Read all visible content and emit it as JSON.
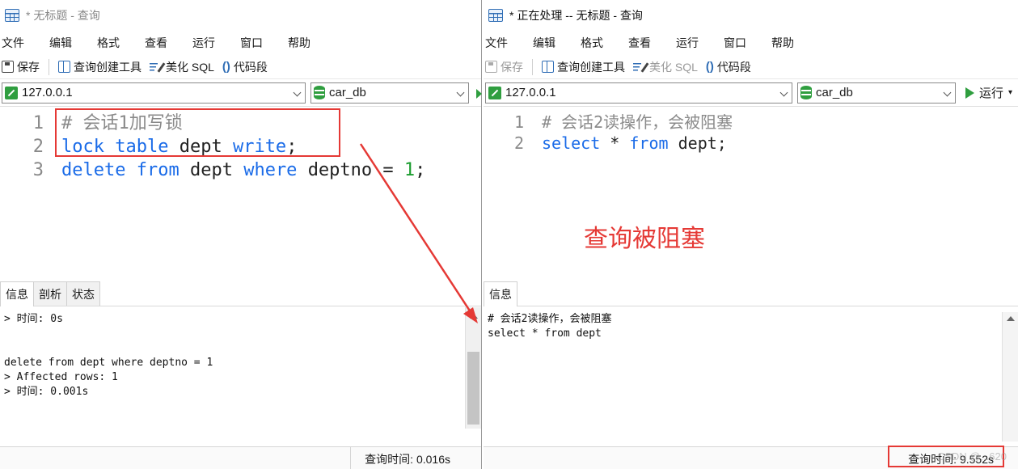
{
  "left": {
    "title": "* 无标题 - 查询",
    "menu": [
      "文件",
      "编辑",
      "格式",
      "查看",
      "运行",
      "窗口",
      "帮助"
    ],
    "toolbar": {
      "save": "保存",
      "query_builder": "查询创建工具",
      "beautify": "美化 SQL",
      "snippet": "代码段"
    },
    "connection": "127.0.0.1",
    "database": "car_db",
    "gutter": [
      "1",
      "2",
      "3"
    ],
    "code": {
      "l1": "# 会话1加写锁",
      "l2_kw1": "lock",
      "l2_kw2": "table",
      "l2_id": "dept",
      "l2_kw3": "write",
      "l2_end": ";",
      "l3_kw1": "delete",
      "l3_kw2": "from",
      "l3_id": "dept",
      "l3_kw3": "where",
      "l3_col": "deptno =",
      "l3_num": "1",
      "l3_end": ";"
    },
    "tabs": [
      "信息",
      "剖析",
      "状态"
    ],
    "info_lines": [
      "> 时间: 0s",
      "",
      "",
      "delete from dept where deptno = 1",
      "> Affected rows: 1",
      "> 时间: 0.001s"
    ],
    "status_time": "查询时间: 0.016s"
  },
  "right": {
    "title": "* 正在处理 -- 无标题 - 查询",
    "menu": [
      "文件",
      "编辑",
      "格式",
      "查看",
      "运行",
      "窗口",
      "帮助"
    ],
    "toolbar": {
      "save": "保存",
      "query_builder": "查询创建工具",
      "beautify": "美化 SQL",
      "snippet": "代码段"
    },
    "connection": "127.0.0.1",
    "database": "car_db",
    "run": "运行",
    "gutter": [
      "1",
      "2"
    ],
    "code": {
      "l1": "# 会话2读操作，会被阻塞",
      "l2_kw1": "select",
      "l2_star": "*",
      "l2_kw2": "from",
      "l2_id": "dept",
      "l2_end": ";"
    },
    "tabs": [
      "信息"
    ],
    "info_lines": [
      "# 会话2读操作，会被阻塞",
      "select * from dept"
    ],
    "status_time": "查询时间: 9.552s"
  },
  "annotation": "查询被阻塞",
  "watermark": "CSDN @...620",
  "colors": {
    "keyword": "#1a6be8",
    "number": "#1a9c2e",
    "comment": "#8a8a8a",
    "highlight": "#e53935"
  }
}
